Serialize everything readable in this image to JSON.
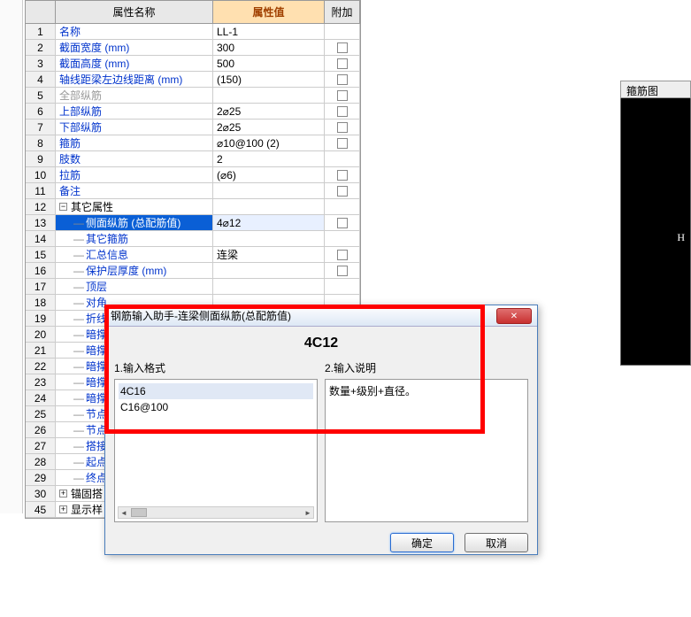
{
  "headers": {
    "name": "属性名称",
    "value": "属性值",
    "extra": "附加"
  },
  "rows": [
    {
      "n": "1",
      "name": "名称",
      "val": "LL-1",
      "link": true,
      "chk": false
    },
    {
      "n": "2",
      "name": "截面宽度 (mm)",
      "val": "300",
      "link": true,
      "chk": true
    },
    {
      "n": "3",
      "name": "截面高度 (mm)",
      "val": "500",
      "link": true,
      "chk": true
    },
    {
      "n": "4",
      "name": "轴线距梁左边线距离 (mm)",
      "val": "(150)",
      "link": true,
      "chk": true
    },
    {
      "n": "5",
      "name": "全部纵筋",
      "val": "",
      "gray": true,
      "chk": true
    },
    {
      "n": "6",
      "name": "上部纵筋",
      "val": "2⌀25",
      "link": true,
      "chk": true
    },
    {
      "n": "7",
      "name": "下部纵筋",
      "val": "2⌀25",
      "link": true,
      "chk": true
    },
    {
      "n": "8",
      "name": "箍筋",
      "val": "⌀10@100 (2)",
      "link": true,
      "chk": true
    },
    {
      "n": "9",
      "name": "肢数",
      "val": "2",
      "link": true,
      "chk": false
    },
    {
      "n": "10",
      "name": "拉筋",
      "val": "(⌀6)",
      "link": true,
      "chk": true
    },
    {
      "n": "11",
      "name": "备注",
      "val": "",
      "link": true,
      "chk": true
    },
    {
      "n": "12",
      "name": "其它属性",
      "val": "",
      "group": true,
      "toggle": "−"
    },
    {
      "n": "13",
      "name": "侧面纵筋 (总配筋值)",
      "val": "4⌀12",
      "link": true,
      "chk": true,
      "selected": true,
      "indent": true
    },
    {
      "n": "14",
      "name": "其它箍筋",
      "val": "",
      "link": true,
      "chk": false,
      "indent": true
    },
    {
      "n": "15",
      "name": "汇总信息",
      "val": "连梁",
      "link": true,
      "chk": true,
      "indent": true
    },
    {
      "n": "16",
      "name": "保护层厚度 (mm)",
      "val": "",
      "link": true,
      "chk": true,
      "indent": true
    },
    {
      "n": "17",
      "name": "顶层",
      "val": "",
      "link": true,
      "indent": true
    },
    {
      "n": "18",
      "name": "对角",
      "val": "",
      "link": true,
      "indent": true
    },
    {
      "n": "19",
      "name": "折线",
      "val": "",
      "link": true,
      "indent": true
    },
    {
      "n": "20",
      "name": "暗撑",
      "val": "",
      "link": true,
      "indent": true
    },
    {
      "n": "21",
      "name": "暗撑",
      "val": "",
      "link": true,
      "indent": true
    },
    {
      "n": "22",
      "name": "暗撑",
      "val": "",
      "link": true,
      "indent": true
    },
    {
      "n": "23",
      "name": "暗撑",
      "val": "",
      "link": true,
      "indent": true
    },
    {
      "n": "24",
      "name": "暗撑",
      "val": "",
      "link": true,
      "indent": true
    },
    {
      "n": "25",
      "name": "节点",
      "val": "",
      "link": true,
      "indent": true
    },
    {
      "n": "26",
      "name": "节点",
      "val": "",
      "link": true,
      "indent": true
    },
    {
      "n": "27",
      "name": "搭接",
      "val": "",
      "link": true,
      "indent": true
    },
    {
      "n": "28",
      "name": "起点",
      "val": "",
      "link": true,
      "indent": true
    },
    {
      "n": "29",
      "name": "终点",
      "val": "",
      "link": true,
      "indent": true
    },
    {
      "n": "30",
      "name": "锚固搭",
      "val": "",
      "group": true,
      "toggle": "+"
    },
    {
      "n": "45",
      "name": "显示样",
      "val": "",
      "group": true,
      "toggle": "+"
    }
  ],
  "dialog": {
    "title": "钢筋输入助手-连梁侧面纵筋(总配筋值)",
    "heading": "4C12",
    "col1_label": "1.输入格式",
    "col1_items": [
      "4C16",
      "C16@100"
    ],
    "col2_label": "2.输入说明",
    "col2_text": "数量+级别+直径。",
    "ok": "确定",
    "cancel": "取消"
  },
  "side_panel": {
    "title": "箍筋图",
    "label": "H"
  }
}
